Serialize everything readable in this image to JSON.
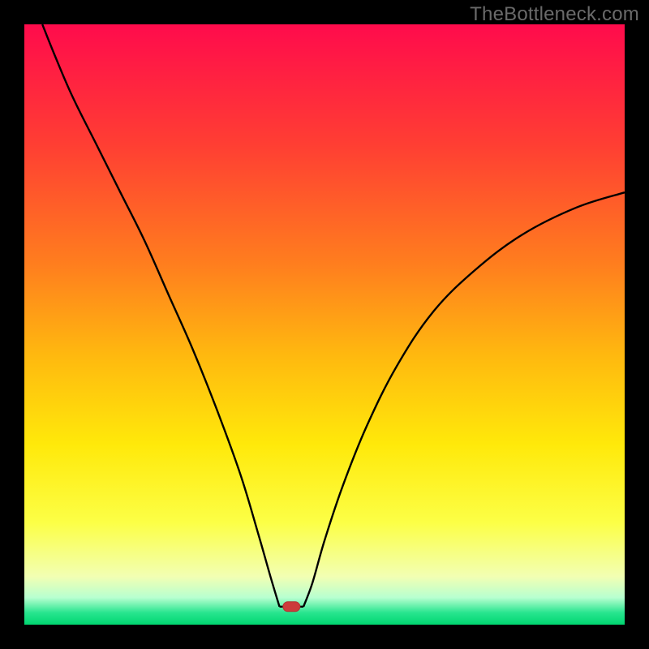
{
  "watermark": "TheBottleneck.com",
  "colors": {
    "frame": "#000000",
    "gradient_stops": [
      {
        "offset": 0.0,
        "color": "#ff0b4c"
      },
      {
        "offset": 0.2,
        "color": "#ff3e33"
      },
      {
        "offset": 0.4,
        "color": "#ff7e1e"
      },
      {
        "offset": 0.55,
        "color": "#ffb80f"
      },
      {
        "offset": 0.7,
        "color": "#ffe90a"
      },
      {
        "offset": 0.83,
        "color": "#fcff46"
      },
      {
        "offset": 0.92,
        "color": "#f2ffb3"
      },
      {
        "offset": 0.955,
        "color": "#b7ffd0"
      },
      {
        "offset": 0.98,
        "color": "#28e58f"
      },
      {
        "offset": 1.0,
        "color": "#00d670"
      }
    ],
    "curve": "#000000",
    "marker_fill": "#cc3b3b",
    "marker_stroke": "#b23434"
  },
  "chart_data": {
    "type": "line",
    "title": "",
    "xlabel": "",
    "ylabel": "",
    "xlim": [
      0,
      100
    ],
    "ylim": [
      0,
      100
    ],
    "grid": false,
    "annotations": [],
    "marker": {
      "x": 44.5,
      "y": 3
    },
    "flat_segment": {
      "x0": 42.5,
      "x1": 46.5,
      "y": 3
    },
    "series": [
      {
        "name": "left-branch",
        "x": [
          3,
          5,
          8,
          12,
          16,
          20,
          24,
          28,
          32,
          36,
          39,
          41,
          42.5
        ],
        "y": [
          100,
          95,
          88,
          80,
          72,
          64,
          55,
          46,
          36,
          25,
          15,
          8,
          3
        ]
      },
      {
        "name": "right-branch",
        "x": [
          46.5,
          48,
          50,
          53,
          57,
          62,
          68,
          75,
          83,
          92,
          100
        ],
        "y": [
          3,
          7,
          14,
          23,
          33,
          43,
          52,
          59,
          65,
          69.5,
          72
        ]
      }
    ]
  }
}
